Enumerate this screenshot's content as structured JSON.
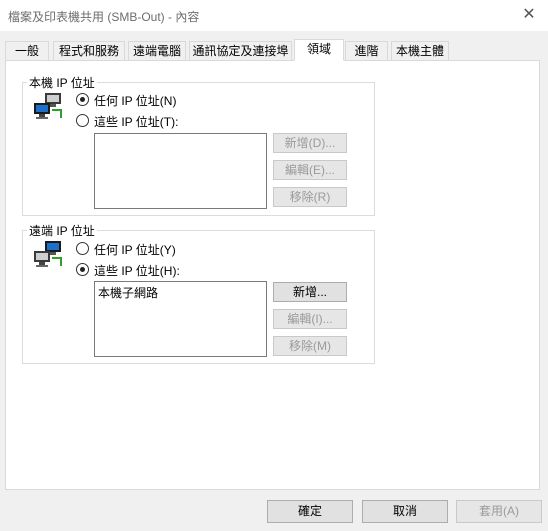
{
  "window": {
    "title": "檔案及印表機共用 (SMB-Out) - 內容",
    "close_glyph": "✕"
  },
  "tabs": [
    {
      "label": "一般",
      "active": false
    },
    {
      "label": "程式和服務",
      "active": false
    },
    {
      "label": "遠端電腦",
      "active": false
    },
    {
      "label": "通訊協定及連接埠",
      "active": false
    },
    {
      "label": "領域",
      "active": true
    },
    {
      "label": "進階",
      "active": false
    },
    {
      "label": "本機主體",
      "active": false
    }
  ],
  "local_ip": {
    "title": "本機 IP 位址",
    "icon": "network-computers-icon",
    "any_label": "任何 IP 位址(N)",
    "any_selected": true,
    "these_label": "這些 IP 位址(T):",
    "these_selected": false,
    "list_items": [],
    "add_label": "新增(D)...",
    "edit_label": "編輯(E)...",
    "remove_label": "移除(R)"
  },
  "remote_ip": {
    "title": "遠端 IP 位址",
    "icon": "network-computers-icon",
    "any_label": "任何 IP 位址(Y)",
    "any_selected": false,
    "these_label": "這些 IP 位址(H):",
    "these_selected": true,
    "list_items": [
      "本機子網路"
    ],
    "add_label": "新增...",
    "edit_label": "編輯(I)...",
    "remove_label": "移除(M)"
  },
  "footer": {
    "ok_label": "確定",
    "cancel_label": "取消",
    "apply_label": "套用(A)"
  },
  "colors": {
    "window_bg": "#f0f0f0",
    "panel_bg": "#ffffff",
    "disabled_text": "#9a9a9a",
    "accent": "#1e6fc8"
  }
}
